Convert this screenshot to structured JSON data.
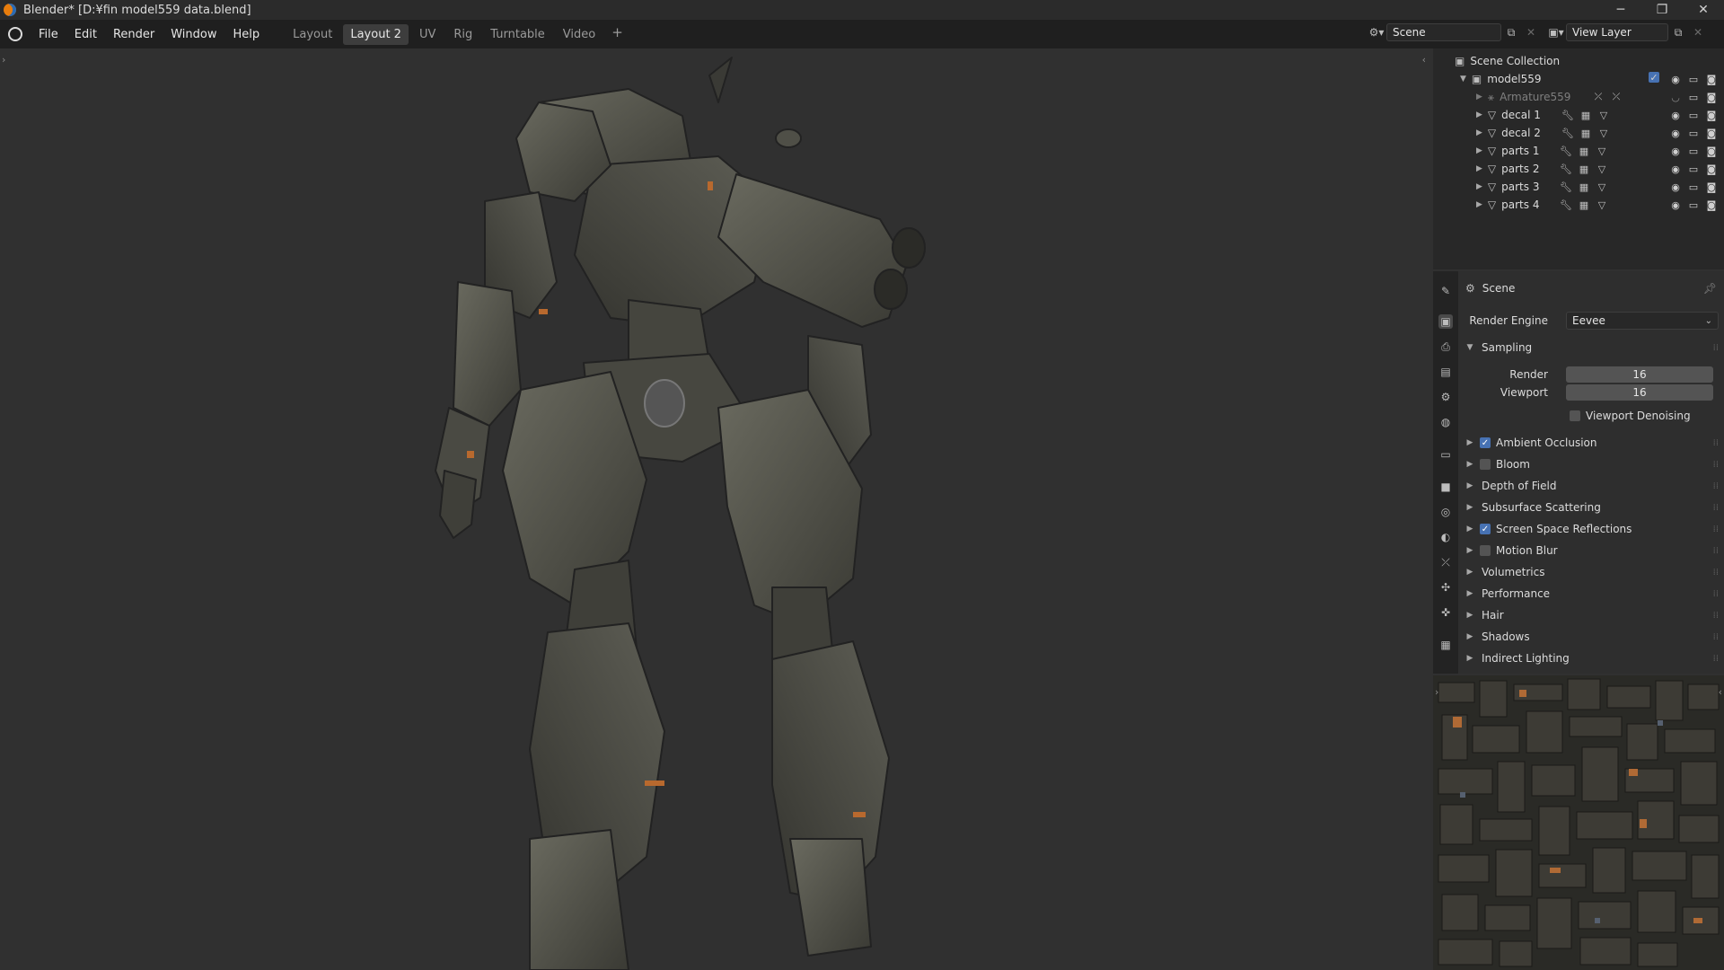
{
  "window": {
    "title": "Blender* [D:¥fin model559 data.blend]",
    "controls": [
      "─",
      "❐",
      "✕"
    ]
  },
  "menu": {
    "items": [
      "File",
      "Edit",
      "Render",
      "Window",
      "Help"
    ]
  },
  "workspaces": {
    "tabs": [
      "Layout",
      "Layout 2",
      "UV",
      "Rig",
      "Turntable",
      "Video"
    ],
    "active": "Layout 2",
    "add": "+"
  },
  "scene_selector": {
    "value": "Scene"
  },
  "view_layer_selector": {
    "value": "View Layer"
  },
  "outliner": {
    "root": "Scene Collection",
    "collection": "model559",
    "items": [
      {
        "name": "Armature559",
        "type": "armature",
        "dimmed": true
      },
      {
        "name": "decal 1",
        "type": "mesh"
      },
      {
        "name": "decal 2",
        "type": "mesh"
      },
      {
        "name": "parts 1",
        "type": "mesh"
      },
      {
        "name": "parts 2",
        "type": "mesh"
      },
      {
        "name": "parts 3",
        "type": "mesh"
      },
      {
        "name": "parts 4",
        "type": "mesh"
      }
    ]
  },
  "properties": {
    "context": "Scene",
    "render_engine_label": "Render Engine",
    "render_engine_value": "Eevee",
    "sampling": {
      "header": "Sampling",
      "render_label": "Render",
      "render_value": "16",
      "viewport_label": "Viewport",
      "viewport_value": "16",
      "denoise_label": "Viewport Denoising"
    },
    "panels": [
      {
        "label": "Ambient Occlusion",
        "checkbox": true,
        "checked": true
      },
      {
        "label": "Bloom",
        "checkbox": true,
        "checked": false
      },
      {
        "label": "Depth of Field",
        "checkbox": false
      },
      {
        "label": "Subsurface Scattering",
        "checkbox": false
      },
      {
        "label": "Screen Space Reflections",
        "checkbox": true,
        "checked": true
      },
      {
        "label": "Motion Blur",
        "checkbox": true,
        "checked": false
      },
      {
        "label": "Volumetrics",
        "checkbox": false
      },
      {
        "label": "Performance",
        "checkbox": false
      },
      {
        "label": "Hair",
        "checkbox": false
      },
      {
        "label": "Shadows",
        "checkbox": false
      },
      {
        "label": "Indirect Lighting",
        "checkbox": false
      }
    ]
  },
  "colors": {
    "accent": "#4772b3",
    "orange": "#e87d0d",
    "viewport_bg": "#303030"
  }
}
